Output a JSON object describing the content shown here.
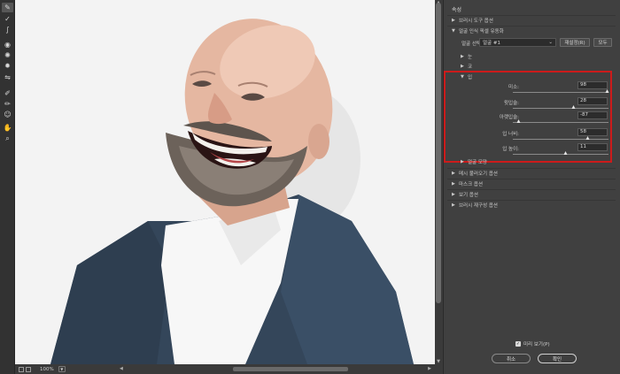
{
  "toolbar": {
    "tools": [
      {
        "icon": "forward-warp-icon",
        "glyph": "✎",
        "active": true
      },
      {
        "icon": "reconstruct-icon",
        "glyph": "✓"
      },
      {
        "icon": "smooth-icon",
        "glyph": "∫"
      },
      {
        "icon": "twirl-icon",
        "glyph": "◉"
      },
      {
        "icon": "pucker-icon",
        "glyph": "✺"
      },
      {
        "icon": "bloat-icon",
        "glyph": "✹"
      },
      {
        "icon": "push-left-icon",
        "glyph": "⇋"
      },
      {
        "icon": "freeze-mask-icon",
        "glyph": "✐"
      },
      {
        "icon": "thaw-mask-icon",
        "glyph": "✏"
      },
      {
        "icon": "face-tool-icon",
        "glyph": "☺"
      },
      {
        "icon": "hand-icon",
        "glyph": "✋"
      },
      {
        "icon": "zoom-icon",
        "glyph": "⌕"
      }
    ]
  },
  "status": {
    "zoom": "100%"
  },
  "panel": {
    "title": "속성",
    "brush_tool_options": "브러시 도구 옵션",
    "face_aware_liquify": "얼굴 인식 픽셀 유동화",
    "face_select_label": "얼굴 선택:",
    "face_select_value": "얼굴 #1",
    "reset_button": "재설정(R)",
    "all_button": "모두",
    "eyes": "눈",
    "nose": "코",
    "mouth": "입",
    "sliders": [
      {
        "label": "미소:",
        "value": 98,
        "fraction": 0.99
      },
      {
        "label": "윗입술:",
        "value": 28,
        "fraction": 0.64
      },
      {
        "label": "아랫입술:",
        "value": -87,
        "fraction": 0.065
      },
      {
        "label": "입 너비:",
        "value": 58,
        "fraction": 0.79
      },
      {
        "label": "입 높이:",
        "value": 11,
        "fraction": 0.555
      }
    ],
    "face_shape": "얼굴 모양",
    "load_mesh": "메시 불러오기 옵션",
    "mask_options": "마스크 옵션",
    "view_options": "보기 옵션",
    "brush_reconstruct": "브러시 재구성 옵션",
    "preview_label": "미리 보기(P)",
    "cancel_button": "취소",
    "ok_button": "확인"
  },
  "colors": {
    "highlight": "#cc1b1b",
    "panel": "#404040",
    "canvas_bg": "#f3f3f3"
  }
}
